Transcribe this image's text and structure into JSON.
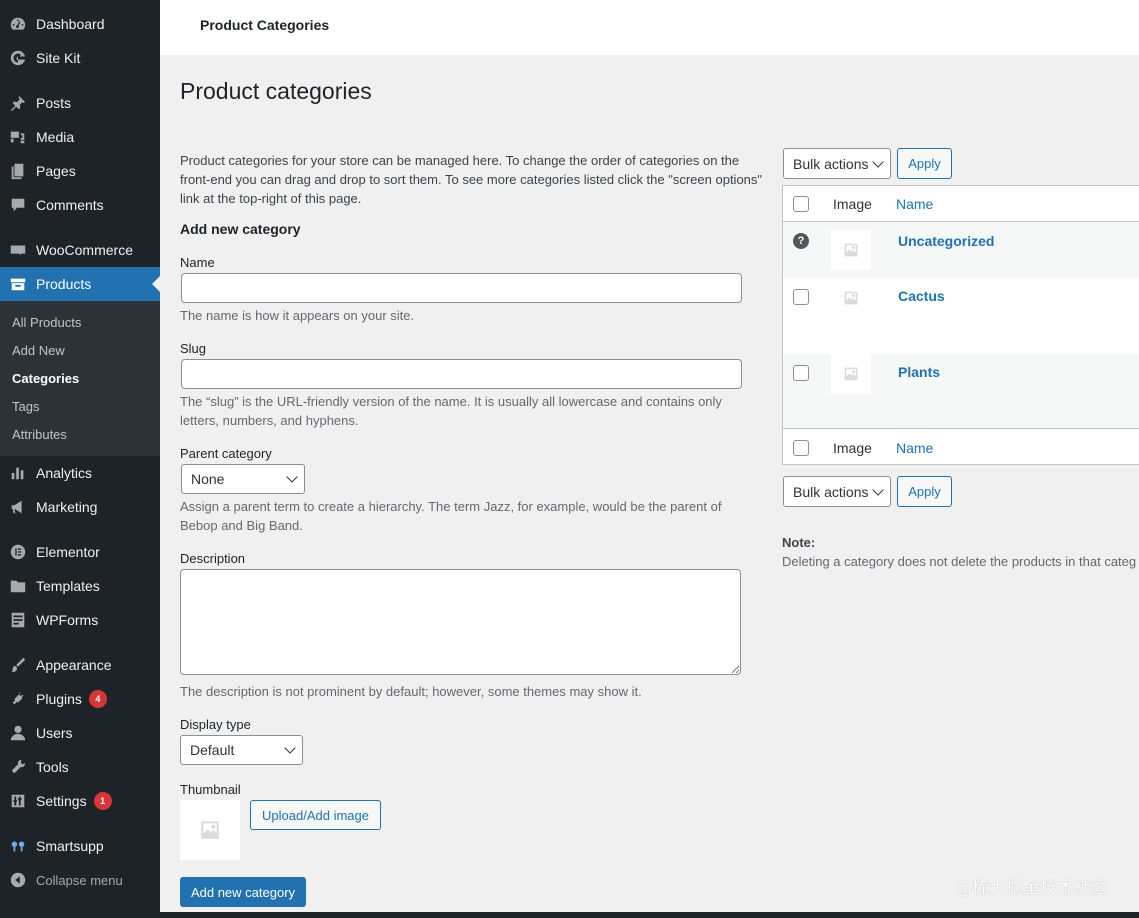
{
  "sidebar": {
    "items": [
      {
        "label": "Dashboard",
        "icon": "dashboard-icon"
      },
      {
        "label": "Site Kit",
        "icon": "site-kit-icon"
      },
      {
        "label": "Posts",
        "icon": "pin-icon"
      },
      {
        "label": "Media",
        "icon": "media-icon"
      },
      {
        "label": "Pages",
        "icon": "pages-icon"
      },
      {
        "label": "Comments",
        "icon": "comment-icon"
      },
      {
        "label": "WooCommerce",
        "icon": "woocommerce-icon"
      },
      {
        "label": "Products",
        "icon": "archive-icon"
      },
      {
        "label": "Analytics",
        "icon": "bar-chart-icon"
      },
      {
        "label": "Marketing",
        "icon": "megaphone-icon"
      },
      {
        "label": "Elementor",
        "icon": "elementor-icon"
      },
      {
        "label": "Templates",
        "icon": "folder-icon"
      },
      {
        "label": "WPForms",
        "icon": "form-icon"
      },
      {
        "label": "Appearance",
        "icon": "paintbrush-icon"
      },
      {
        "label": "Plugins",
        "icon": "plug-icon",
        "badge": "4"
      },
      {
        "label": "Users",
        "icon": "user-icon"
      },
      {
        "label": "Tools",
        "icon": "wrench-icon"
      },
      {
        "label": "Settings",
        "icon": "sliders-icon",
        "badge": "1"
      },
      {
        "label": "Smartsupp",
        "icon": "smartsupp-icon"
      },
      {
        "label": "Collapse menu",
        "icon": "collapse-icon"
      }
    ],
    "submenu": [
      "All Products",
      "Add New",
      "Categories",
      "Tags",
      "Attributes"
    ],
    "active": "Products",
    "current_sub": "Categories"
  },
  "topbar": {
    "title": "Product Categories"
  },
  "page": {
    "title": "Product categories",
    "intro": "Product categories for your store can be managed here. To change the order of categories on the front-end you can drag and drop to sort them. To see more categories listed click the \"screen options\" link at the top-right of this page."
  },
  "form": {
    "heading": "Add new category",
    "name_label": "Name",
    "name_value": "",
    "name_help": "The name is how it appears on your site.",
    "slug_label": "Slug",
    "slug_value": "",
    "slug_help": "The “slug” is the URL-friendly version of the name. It is usually all lowercase and contains only letters, numbers, and hyphens.",
    "parent_label": "Parent category",
    "parent_value": "None",
    "parent_help": "Assign a parent term to create a hierarchy. The term Jazz, for example, would be the parent of Bebop and Big Band.",
    "description_label": "Description",
    "description_value": "",
    "description_help": "The description is not prominent by default; however, some themes may show it.",
    "display_label": "Display type",
    "display_value": "Default",
    "thumbnail_label": "Thumbnail",
    "upload_button": "Upload/Add image",
    "submit_button": "Add new category"
  },
  "table": {
    "bulk_actions": "Bulk actions",
    "apply": "Apply",
    "col_image": "Image",
    "col_name": "Name",
    "rows": [
      {
        "name": "Uncategorized",
        "default": true
      },
      {
        "name": "Cactus",
        "default": false
      },
      {
        "name": "Plants",
        "default": false
      }
    ],
    "note_title": "Note:",
    "note_text": "Deleting a category does not delete the products in that categ"
  },
  "watermark": "@稀土掘金技术社区",
  "colors": {
    "sidebar": "#1d2327",
    "accent": "#2271b1",
    "badge": "#d63638"
  }
}
